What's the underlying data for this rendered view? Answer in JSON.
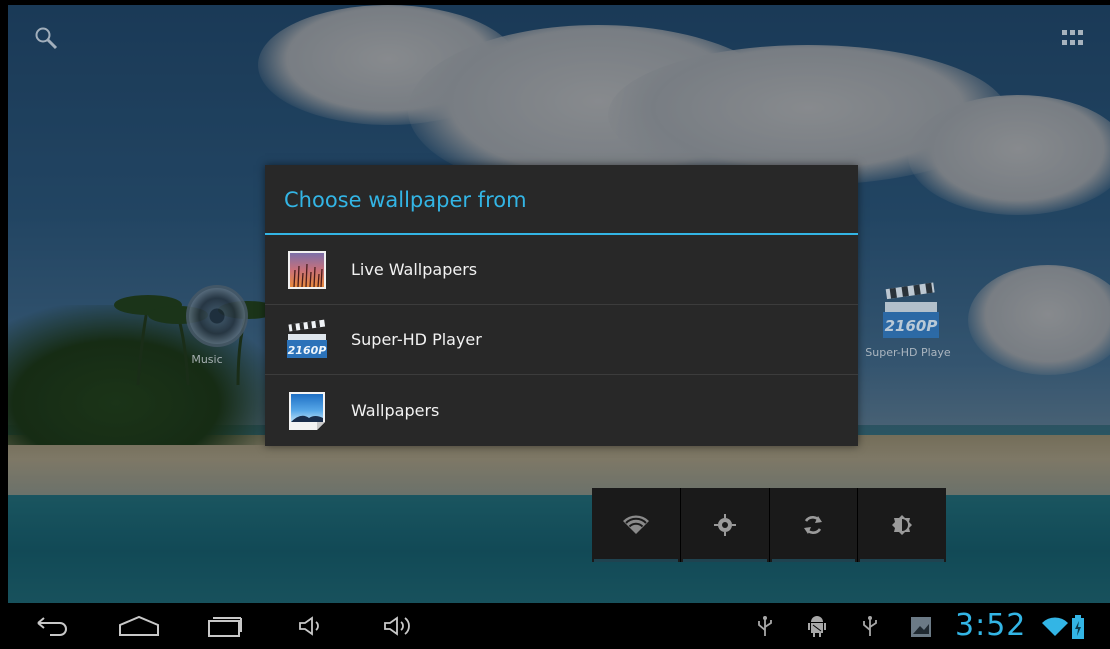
{
  "dialog": {
    "title": "Choose wallpaper from",
    "options": [
      {
        "label": "Live Wallpapers",
        "icon": "live-wallpapers-icon"
      },
      {
        "label": "Super-HD Player",
        "icon": "super-hd-player-icon"
      },
      {
        "label": "Wallpapers",
        "icon": "wallpapers-icon"
      }
    ]
  },
  "desktop": {
    "music_label": "Music",
    "player_label": "Super-HD Playe",
    "player_badge": "2160P"
  },
  "option_badge": "2160P",
  "statusbar": {
    "time": "3:52"
  },
  "colors": {
    "accent": "#33b5e5",
    "dialog_bg": "#282828",
    "navbar_bg": "#000000"
  }
}
